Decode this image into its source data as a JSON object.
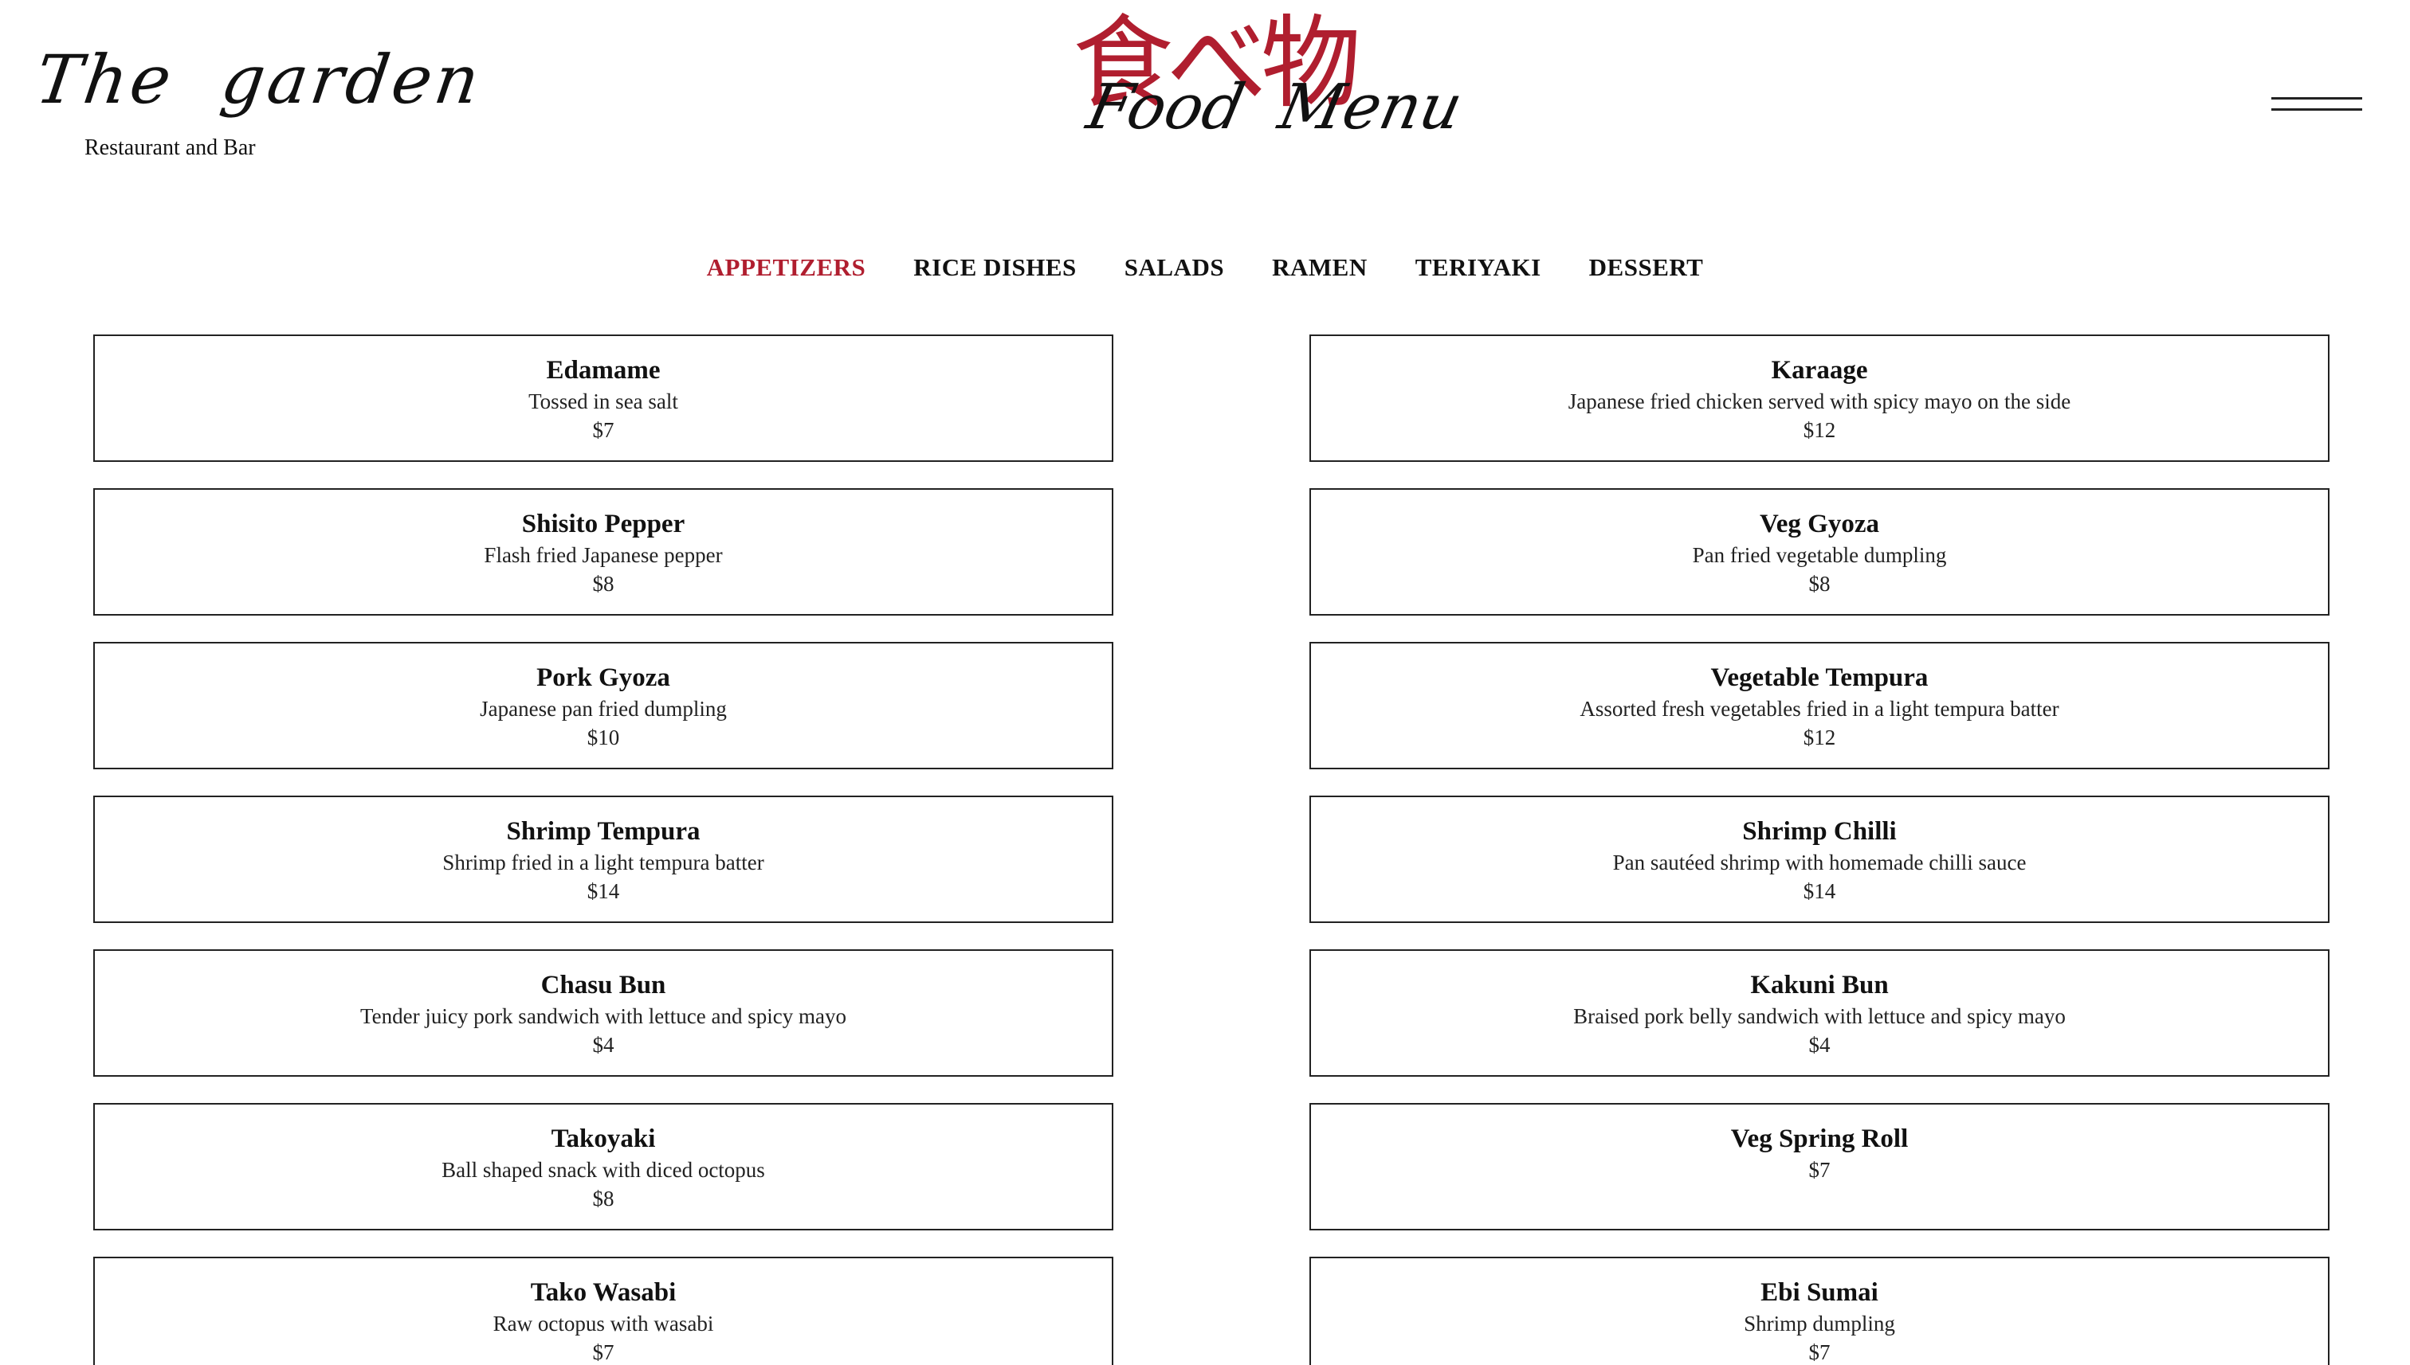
{
  "header": {
    "brand_script": "The garden",
    "brand_subtitle": "Restaurant and Bar",
    "logo_kanji": "食べ物",
    "logo_script": "Food Menu"
  },
  "menu_icon": "hamburger-icon",
  "colors": {
    "accent": "#b01e2f",
    "text": "#111111",
    "border": "#222222",
    "background": "#ffffff"
  },
  "tabs": [
    {
      "label": "APPETIZERS",
      "active": true
    },
    {
      "label": "RICE DISHES",
      "active": false
    },
    {
      "label": "SALADS",
      "active": false
    },
    {
      "label": "RAMEN",
      "active": false
    },
    {
      "label": "TERIYAKI",
      "active": false
    },
    {
      "label": "DESSERT",
      "active": false
    }
  ],
  "items": [
    {
      "name": "Edamame",
      "desc": "Tossed in sea salt",
      "price": "$7"
    },
    {
      "name": "Karaage",
      "desc": "Japanese fried chicken served with spicy mayo on the side",
      "price": "$12"
    },
    {
      "name": "Shisito Pepper",
      "desc": "Flash fried Japanese pepper",
      "price": "$8"
    },
    {
      "name": "Veg Gyoza",
      "desc": "Pan fried vegetable dumpling",
      "price": "$8"
    },
    {
      "name": "Pork Gyoza",
      "desc": "Japanese pan fried dumpling",
      "price": "$10"
    },
    {
      "name": "Vegetable Tempura",
      "desc": "Assorted fresh vegetables fried in a light tempura batter",
      "price": "$12"
    },
    {
      "name": "Shrimp Tempura",
      "desc": "Shrimp fried in a light tempura batter",
      "price": "$14"
    },
    {
      "name": "Shrimp Chilli",
      "desc": "Pan sautéed shrimp with homemade chilli sauce",
      "price": "$14"
    },
    {
      "name": "Chasu Bun",
      "desc": "Tender juicy pork sandwich with lettuce and spicy mayo",
      "price": "$4"
    },
    {
      "name": "Kakuni Bun",
      "desc": "Braised pork belly sandwich with lettuce and spicy mayo",
      "price": "$4"
    },
    {
      "name": "Takoyaki",
      "desc": "Ball shaped snack with diced octopus",
      "price": "$8"
    },
    {
      "name": "Veg Spring Roll",
      "desc": "",
      "price": "$7"
    },
    {
      "name": "Tako Wasabi",
      "desc": "Raw octopus with wasabi",
      "price": "$7"
    },
    {
      "name": "Ebi Sumai",
      "desc": "Shrimp dumpling",
      "price": "$7"
    }
  ]
}
